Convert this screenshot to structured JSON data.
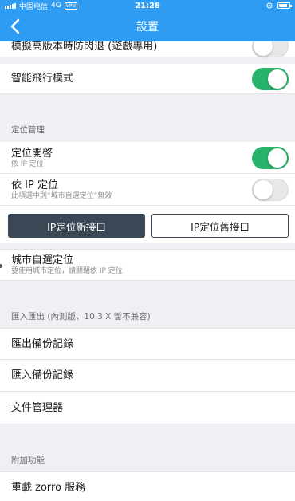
{
  "status": {
    "carrier": "中国电信",
    "network": "4G",
    "vpn": "VPN",
    "time": "21:28"
  },
  "nav": {
    "title": "設置"
  },
  "rows": {
    "simulate": {
      "label": "模擬高版本時防閃退 (遊戲專用)",
      "toggle_on": false
    },
    "smart_flight": {
      "label": "智能飛行模式",
      "toggle_on": true
    }
  },
  "location": {
    "header": "定位管理",
    "enable": {
      "label": "定位開啓",
      "sub": "依 IP 定位",
      "toggle_on": true
    },
    "by_ip": {
      "label": "依 IP 定位",
      "sub": "此項選中則“城市自選定位”無效",
      "toggle_on": false
    },
    "btn_new": "IP定位新接口",
    "btn_old": "IP定位舊接口",
    "city": {
      "label": "城市自選定位",
      "sub": "要使用城市定位，請關閉依 IP 定位"
    }
  },
  "import_export": {
    "header": "匯入匯出 (內測版，10.3.X 暫不兼容)",
    "export": "匯出備份記錄",
    "import": "匯入備份記錄",
    "files": "文件管理器"
  },
  "extra": {
    "header": "附加功能",
    "reload": "重載 zorro 服務"
  },
  "colors": {
    "nav_blue": "#2f9cf3",
    "toggle_green": "#28b36a",
    "button_dark": "#3a4754"
  }
}
